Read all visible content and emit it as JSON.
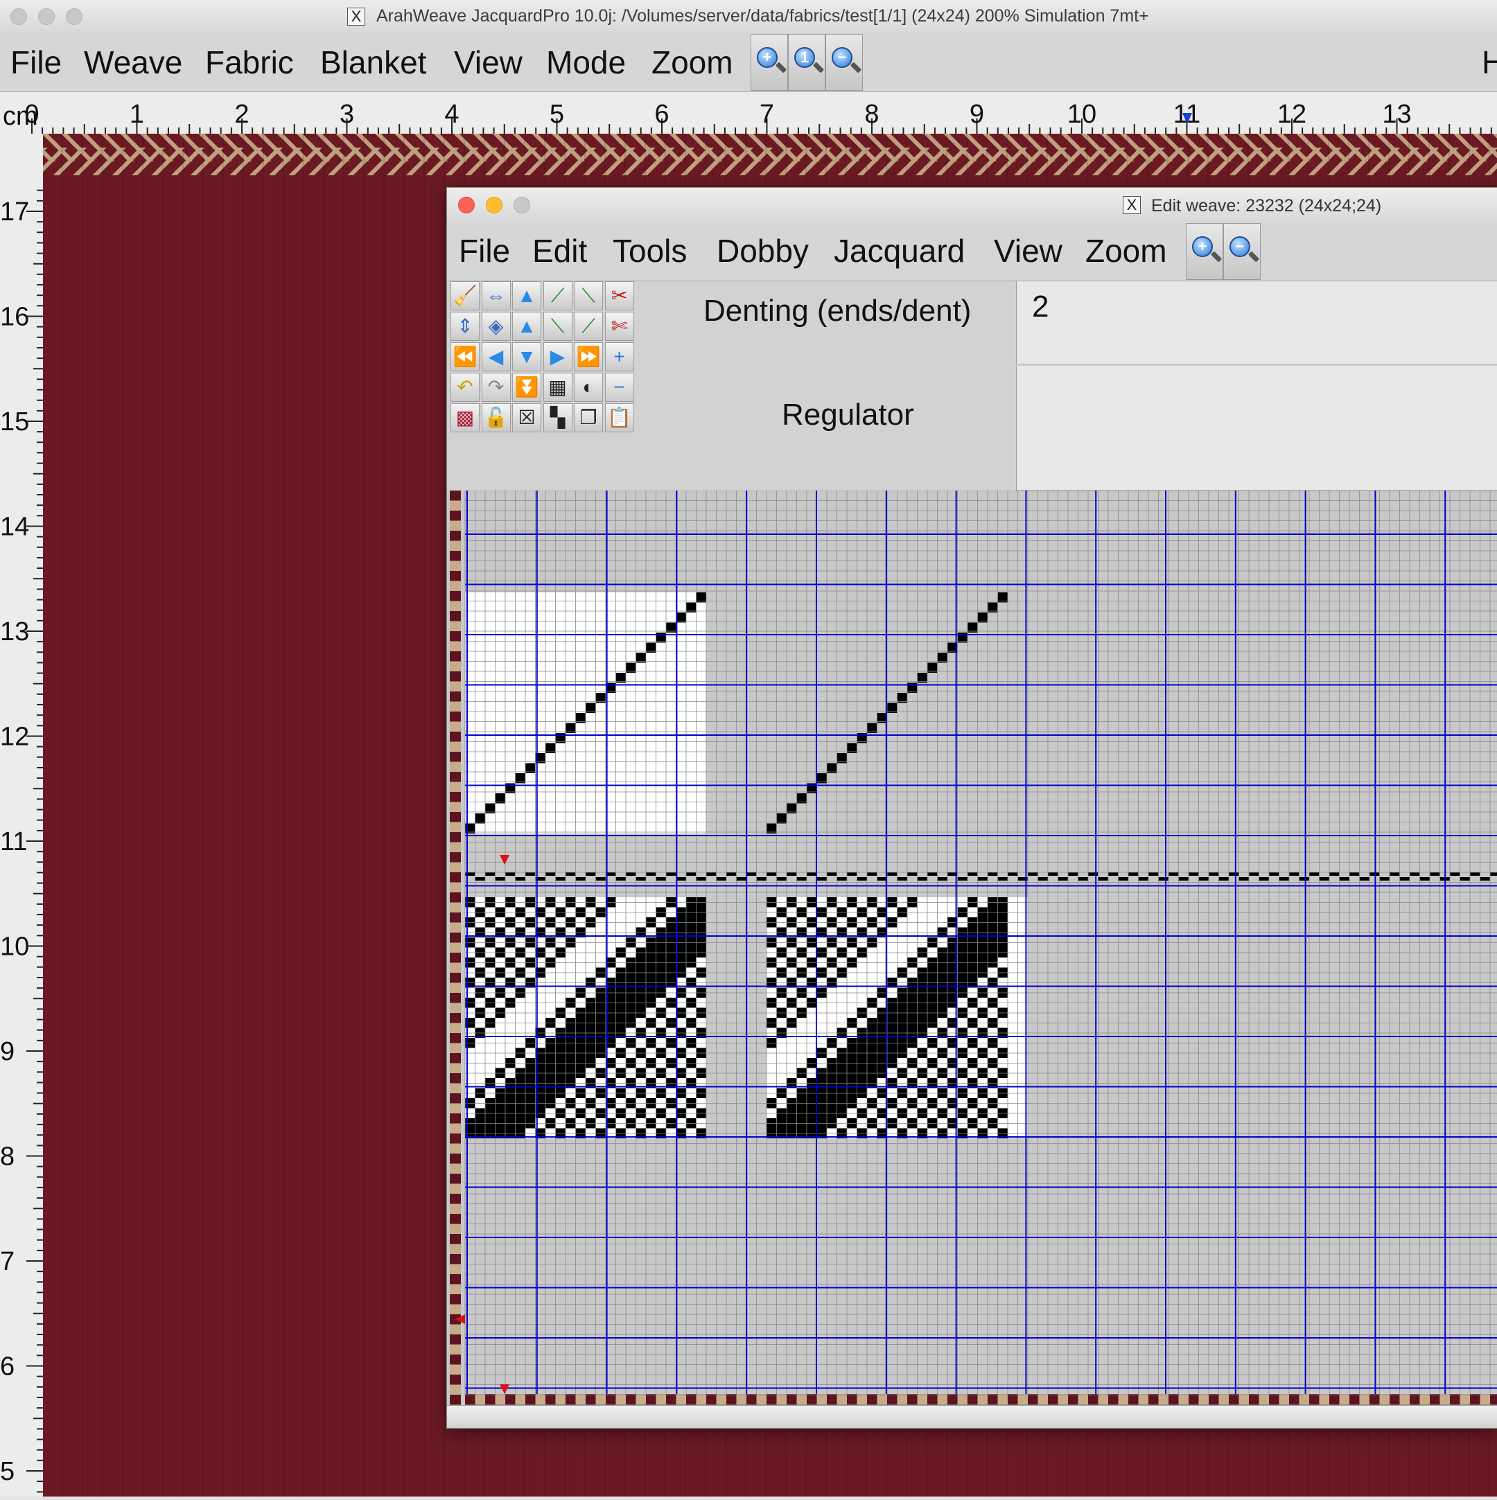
{
  "app": {
    "title": "ArahWeave JacquardPro 10.0j: /Volumes/server/data/fabrics/test[1/1] (24x24) 200% Simulation 7mt+",
    "title_icon": "X"
  },
  "main_menu": [
    "File",
    "Weave",
    "Fabric",
    "Blanket",
    "View",
    "Mode",
    "Zoom"
  ],
  "main_zoom_buttons": [
    {
      "icon": "zoom-in-icon",
      "glyph": "+"
    },
    {
      "icon": "zoom-reset-icon",
      "glyph": "1"
    },
    {
      "icon": "zoom-out-icon",
      "glyph": "−"
    }
  ],
  "main_menu_cut_label": "H",
  "ruler": {
    "unit": "cm",
    "top_ticks": [
      "0",
      "1",
      "2",
      "3",
      "4",
      "5",
      "6",
      "7",
      "8",
      "9",
      "10",
      "11",
      "12",
      "13"
    ],
    "left_ticks": [
      "17",
      "16",
      "15",
      "14",
      "13",
      "12",
      "11",
      "10",
      "9",
      "8",
      "7",
      "6",
      "5"
    ]
  },
  "fabric": {
    "warp_color": "#6b1a24",
    "weft_color": "#bf9f7f"
  },
  "edit_weave": {
    "title": "Edit weave: 23232 (24x24;24)",
    "title_icon": "X",
    "menu": [
      "File",
      "Edit",
      "Tools",
      "Dobby",
      "Jacquard",
      "View",
      "Zoom"
    ],
    "zoom_buttons": [
      {
        "icon": "zoom-in-icon",
        "glyph": "+"
      },
      {
        "icon": "zoom-out-icon",
        "glyph": "−"
      }
    ],
    "tool_icons": [
      [
        "broom-icon",
        "fit-width-icon",
        "shift-up-icon",
        "twill-right-icon",
        "twill-left-icon",
        "cut-icon"
      ],
      [
        "fit-height-icon",
        "paint-bucket-icon",
        "move-up-icon",
        "steep-twill-down-icon",
        "steep-twill-up-icon",
        "cut-pattern-icon"
      ],
      [
        "shift-far-left-icon",
        "shift-left-icon",
        "shift-down-icon",
        "shift-right-icon",
        "shift-far-right-icon",
        "add-icon"
      ],
      [
        "undo-icon",
        "redo-icon",
        "move-down-icon",
        "checker-small-icon",
        "invert-icon",
        "remove-icon"
      ],
      [
        "color-weave-icon",
        "lock-icon",
        "clear-icon",
        "checker-large-icon",
        "copy-icon",
        "paste-icon"
      ]
    ],
    "denting_label": "Denting (ends/dent)",
    "denting_value": "2",
    "regulator_label": "Regulator",
    "regulator_value": "",
    "colors": {
      "grid_line": "#0000cc",
      "fill": "#000000",
      "background": "#c8c8c8",
      "marker": "#dd1111"
    }
  }
}
